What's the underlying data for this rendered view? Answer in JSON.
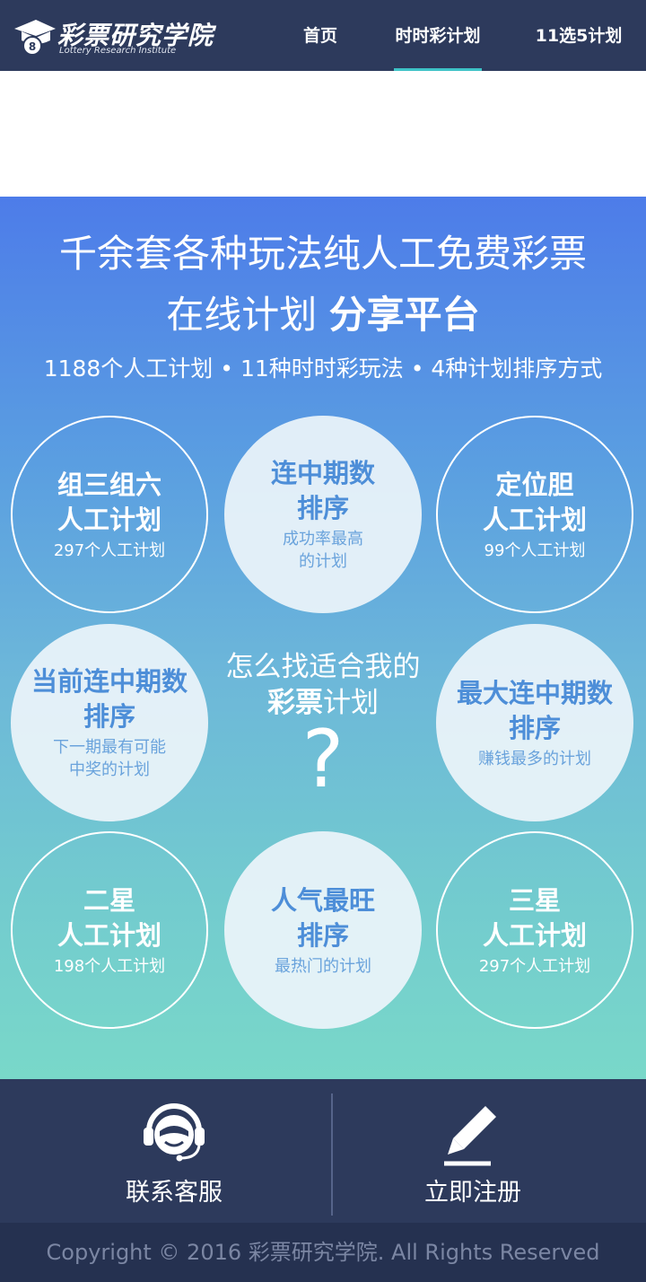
{
  "header": {
    "logo_title": "彩票研究学院",
    "logo_subtitle": "Lottery Research Institute",
    "logo_badge": "8",
    "nav": [
      {
        "label": "首页",
        "active": false
      },
      {
        "label": "时时彩计划",
        "active": true
      },
      {
        "label": "11选5计划",
        "active": false
      }
    ]
  },
  "hero": {
    "headline_line1": "千余套各种玩法纯人工免费彩票",
    "headline_line2_normal": "在线计划",
    "headline_line2_bold": "分享平台",
    "stats": "1188个人工计划 • 11种时时彩玩法 • 4种计划排序方式",
    "circles": [
      {
        "title1": "组三组六",
        "title2": "人工计划",
        "sub1": "297个人工计划",
        "sub2": ""
      },
      {
        "title1": "连中期数",
        "title2": "排序",
        "sub1": "成功率最高",
        "sub2": "的计划"
      },
      {
        "title1": "定位胆",
        "title2": "人工计划",
        "sub1": "99个人工计划",
        "sub2": ""
      },
      {
        "title1": "当前连中期数",
        "title2": "排序",
        "sub1": "下一期最有可能",
        "sub2": "中奖的计划"
      },
      {
        "title1": "最大连中期数",
        "title2": "排序",
        "sub1": "赚钱最多的计划",
        "sub2": ""
      },
      {
        "title1": "二星",
        "title2": "人工计划",
        "sub1": "198个人工计划",
        "sub2": ""
      },
      {
        "title1": "人气最旺",
        "title2": "排序",
        "sub1": "最热门的计划",
        "sub2": ""
      },
      {
        "title1": "三星",
        "title2": "人工计划",
        "sub1": "297个人工计划",
        "sub2": ""
      }
    ],
    "center_line1": "怎么找适合我的",
    "center_line2_bold": "彩票",
    "center_line2_normal": "计划",
    "center_mark": "?"
  },
  "actions": {
    "contact_label": "联系客服",
    "register_label": "立即注册"
  },
  "footer": {
    "copyright": "Copyright © 2016 彩票研究学院. All Rights Reserved"
  },
  "colors": {
    "header_bg": "#2d3a5c",
    "nav_active_underline": "#3ec3c7",
    "hero_top": "#4d7ce9",
    "hero_bottom": "#79d8c9",
    "circle_text": "#4d8ed8",
    "footer_bg": "#253150"
  }
}
